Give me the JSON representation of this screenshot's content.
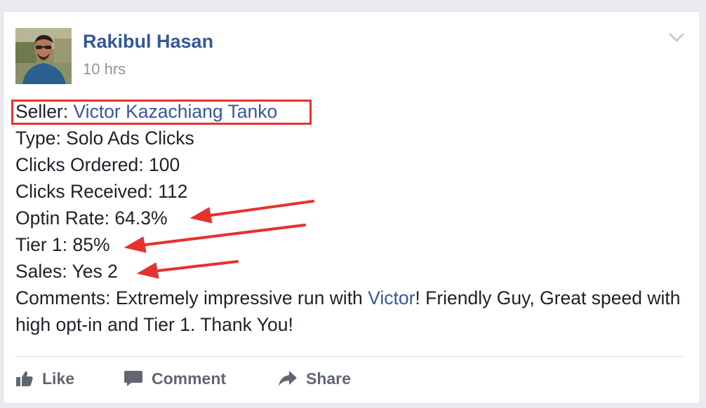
{
  "post": {
    "author": "Rakibul Hasan",
    "timestamp": "10 hrs",
    "seller_label": "Seller: ",
    "seller_name": "Victor Kazachiang Tanko",
    "type": "Type: Solo Ads Clicks",
    "clicks_ordered": "Clicks Ordered: 100",
    "clicks_received": "Clicks Received: 112",
    "optin_rate": "Optin Rate: 64.3%",
    "tier1": "Tier 1: 85%",
    "sales": "Sales: Yes 2",
    "comments_prefix": "Comments: Extremely impressive run with ",
    "comments_link": "Victor",
    "comments_suffix": "! Friendly Guy, Great speed with high opt-in and Tier 1. Thank You!"
  },
  "actions": {
    "like": "Like",
    "comment": "Comment",
    "share": "Share"
  },
  "icons": {
    "menu": "chevron-down-icon",
    "like": "thumbs-up-icon",
    "comment": "speech-bubble-icon",
    "share": "share-arrow-icon"
  },
  "colors": {
    "link": "#365899",
    "text": "#1d2129",
    "muted": "#90949c",
    "action": "#606770",
    "annotation": "#e8312f"
  }
}
